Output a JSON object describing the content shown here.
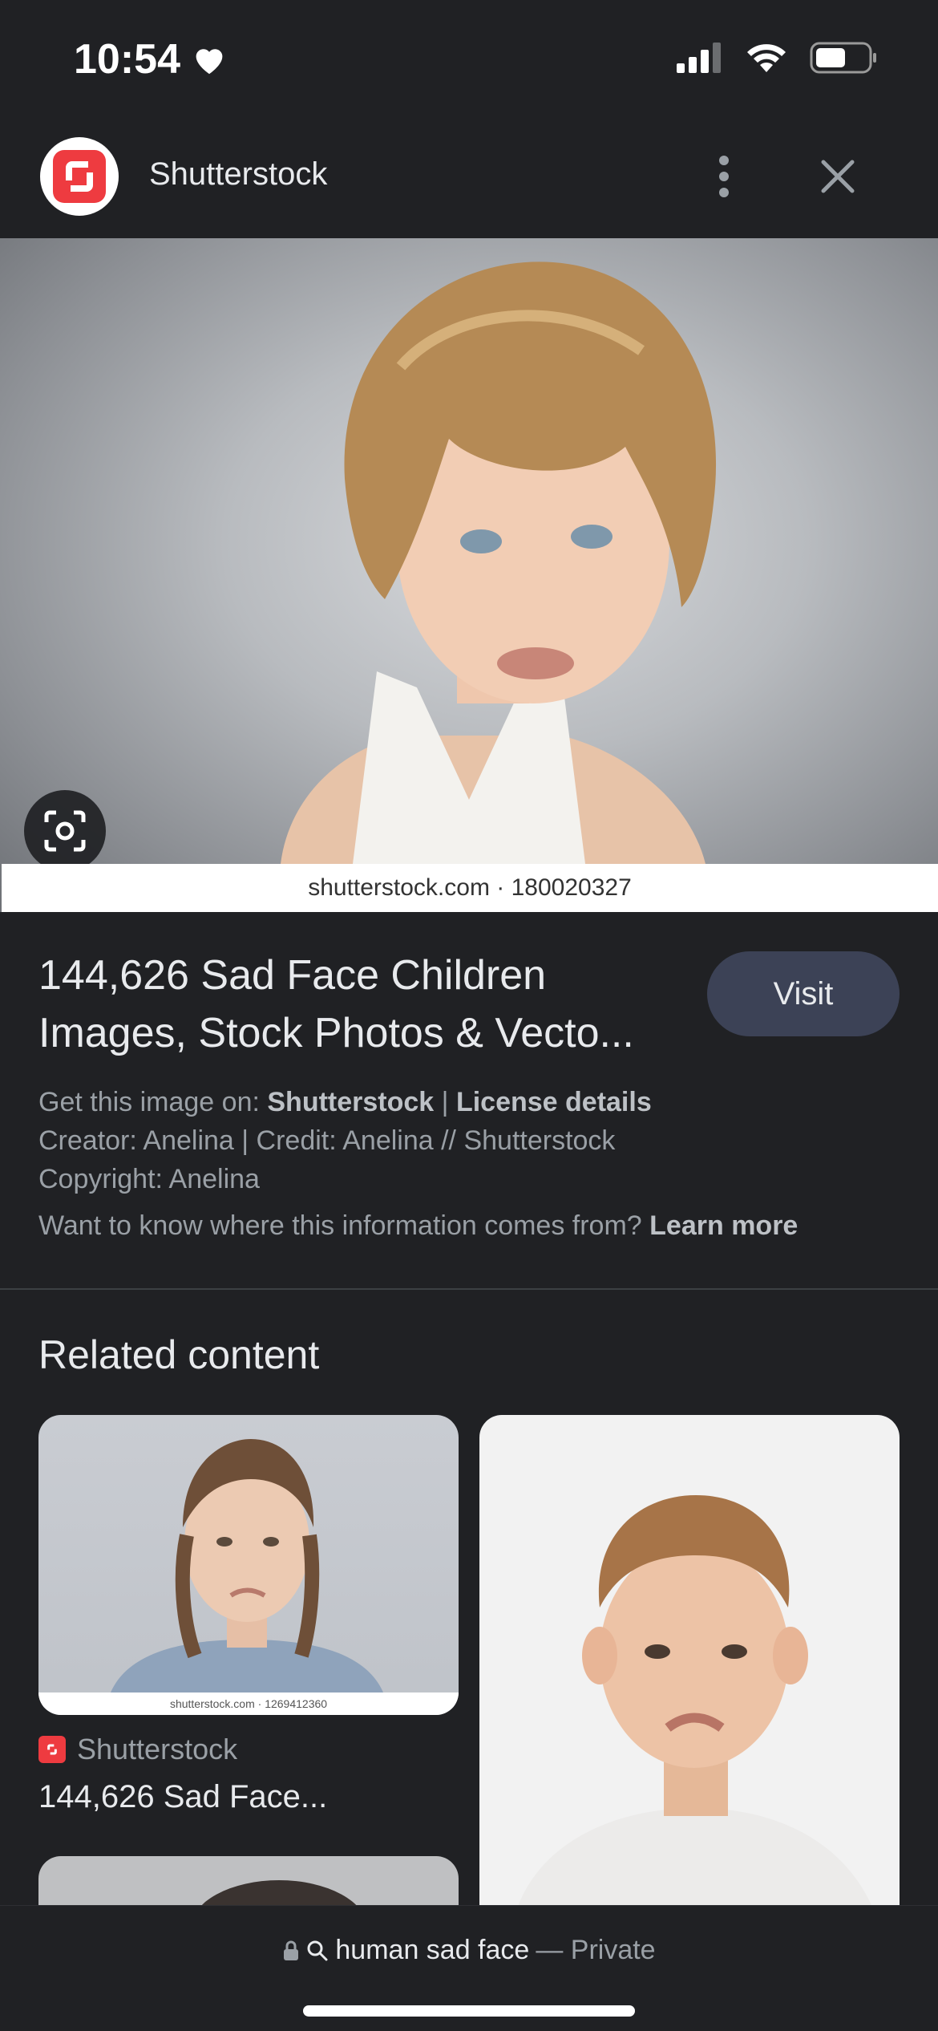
{
  "status_bar": {
    "time": "10:54"
  },
  "header": {
    "site_name": "Shutterstock"
  },
  "hero": {
    "caption": "shutterstock.com · 180020327"
  },
  "result": {
    "title": "144,626 Sad Face Children Images, Stock Photos & Vecto...",
    "visit_label": "Visit",
    "get_image_prefix": "Get this image on:",
    "get_image_source": "Shutterstock",
    "separator": "|",
    "license_details": "License details",
    "creator_line": "Creator: Anelina | Credit: Anelina // Shutterstock",
    "copyright_line": "Copyright: Anelina",
    "info_question": "Want to know where this information comes from?",
    "learn_more": "Learn more"
  },
  "related": {
    "heading": "Related content",
    "cards": [
      {
        "caption": "shutterstock.com · 1269412360",
        "source": "Shutterstock",
        "title": "144,626 Sad Face..."
      }
    ]
  },
  "bottom_bar": {
    "query": "human sad face",
    "mode": "— Private"
  },
  "colors": {
    "background": "#202124",
    "brand_red": "#ee3b40",
    "visit_button": "#3c4256"
  }
}
